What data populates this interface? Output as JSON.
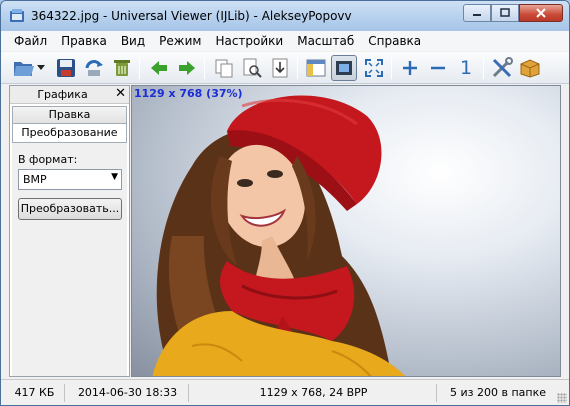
{
  "window": {
    "title": "364322.jpg - Universal Viewer (IJLib) - AlekseyPopovv",
    "min_icon": "minimize-icon",
    "max_icon": "maximize-icon",
    "close_icon": "close-icon"
  },
  "menu": {
    "items": [
      {
        "label": "Файл"
      },
      {
        "label": "Правка"
      },
      {
        "label": "Вид"
      },
      {
        "label": "Режим"
      },
      {
        "label": "Настройки"
      },
      {
        "label": "Масштаб"
      },
      {
        "label": "Справка"
      }
    ]
  },
  "toolbar": {
    "icons": [
      "open-folder-icon",
      "dropdown-arrow-icon",
      "save-icon",
      "reload-icon",
      "delete-icon",
      "prev-arrow-icon",
      "next-arrow-icon",
      "copy-icon",
      "find-icon",
      "export-icon",
      "panel-icon",
      "fit-view-icon",
      "fullscreen-icon",
      "zoom-in-icon",
      "zoom-out-icon",
      "actual-size-icon",
      "settings-tools-icon",
      "package-icon"
    ],
    "actual_size_label": "1",
    "zoom_in_label": "+",
    "zoom_out_label": "−"
  },
  "panel": {
    "title": "Графика",
    "close_label": "✕",
    "tab_edit": "Правка",
    "tab_convert": "Преобразование",
    "format_label": "В формат:",
    "format_value": "BMP",
    "convert_button": "Преобразовать..."
  },
  "viewer": {
    "overlay": "1129 x 768 (37%)"
  },
  "status": {
    "size": "417 КБ",
    "date": "2014-06-30 18:33",
    "info": "1129 x 768, 24 BPP",
    "position": "5 из 200 в папке"
  },
  "colors": {
    "overlay_text": "#1a2dd6",
    "hat": "#c4171e",
    "sweater": "#e8a91d"
  }
}
